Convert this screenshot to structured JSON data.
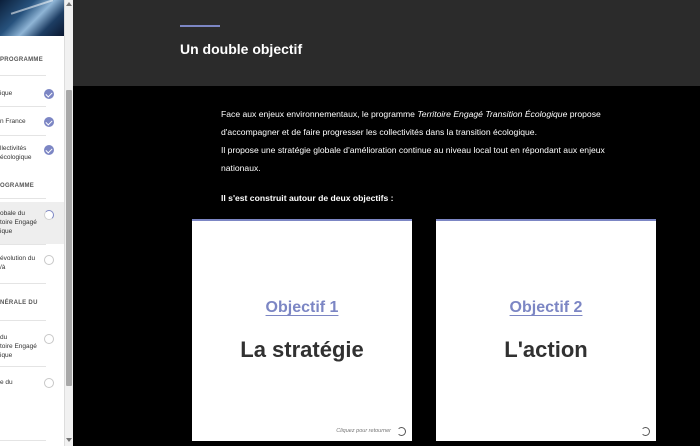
{
  "sidebar": {
    "section_headers": [
      {
        "label": "PROGRAMME"
      },
      {
        "label": "OGRAMME"
      },
      {
        "label": "NÉRALE DU"
      }
    ],
    "items": [
      {
        "label_lines": [
          "ique"
        ],
        "status": "done"
      },
      {
        "label_lines": [
          "n France"
        ],
        "status": "done"
      },
      {
        "label_lines": [
          "llectivités",
          "écologique"
        ],
        "status": "done"
      },
      {
        "label_lines": [
          "obale du",
          "toire Engagé",
          "ique"
        ],
        "status": "in-progress"
      },
      {
        "label_lines": [
          "évolution du",
          "/à"
        ],
        "status": "not-started"
      },
      {
        "label_lines": [
          "du",
          "toire Engagé",
          "ique"
        ],
        "status": "not-started"
      },
      {
        "label_lines": [
          "e du"
        ],
        "status": "not-started"
      }
    ]
  },
  "header": {
    "title": "Un double objectif",
    "accent_color": "#7c86c4"
  },
  "content": {
    "intro_parts": {
      "p1_before": "Face aux enjeux environnementaux, le programme ",
      "p1_em": "Territoire Engagé Transition Écologique",
      "p1_after": " propose d'accompagner et de faire progresser les collectivités dans la transition écologique.",
      "p2": "Il propose une stratégie globale d'amélioration continue au niveau local tout en répondant aux enjeux nationaux."
    },
    "lead": "Il s'est construit autour de deux objectifs :"
  },
  "cards": [
    {
      "kicker": "Objectif 1",
      "title": "La stratégie",
      "hint": "Cliquez pour retourner",
      "icon": "flip-icon"
    },
    {
      "kicker": "Objectif 2",
      "title": "L'action",
      "hint": "",
      "icon": "flip-icon"
    }
  ]
}
